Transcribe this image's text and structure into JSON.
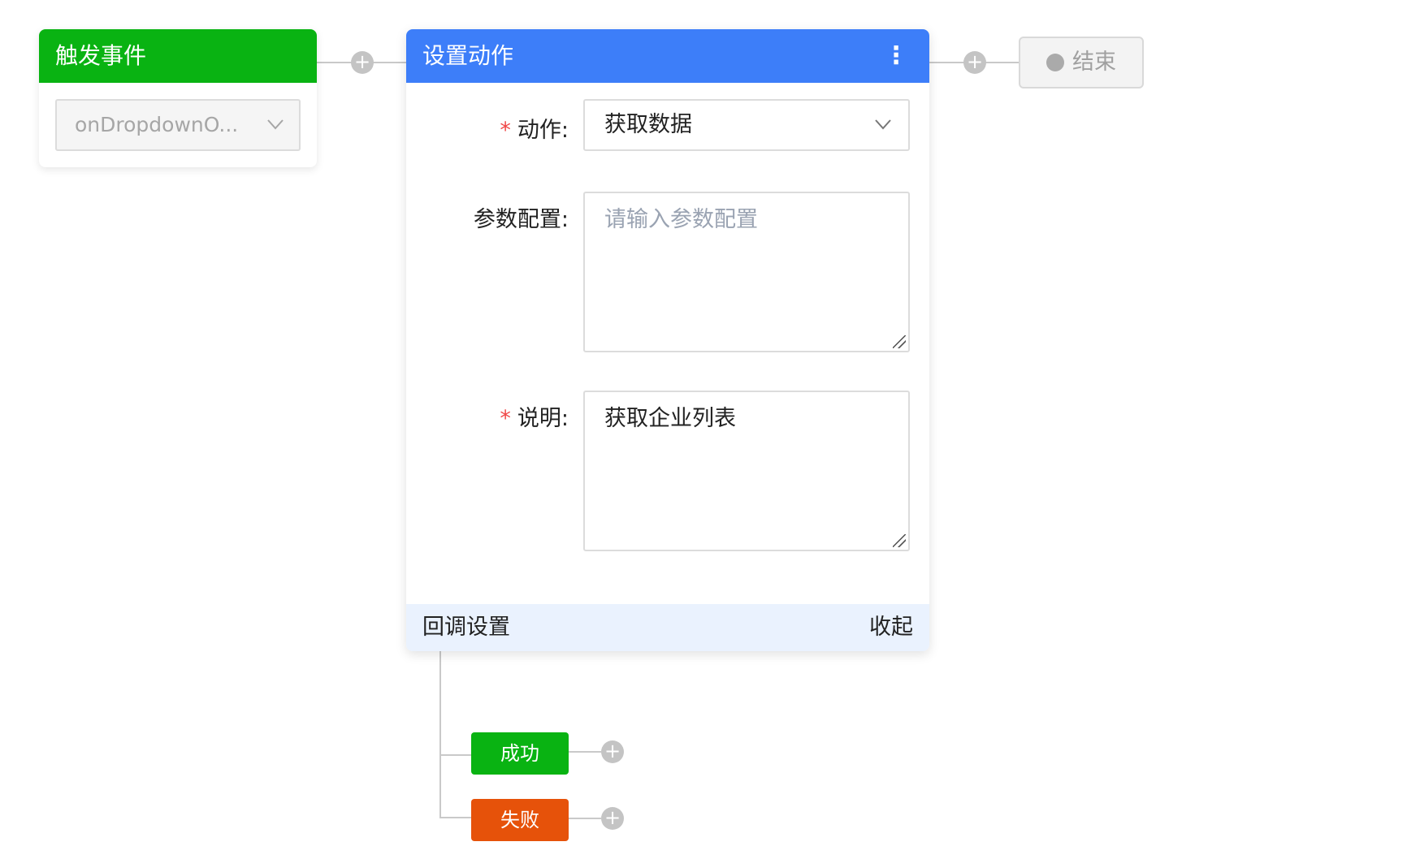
{
  "trigger": {
    "title": "触发事件",
    "event_value": "onDropdownO..."
  },
  "action_card": {
    "title": "设置动作",
    "menu_glyph": "⋮",
    "fields": {
      "action": {
        "label": "动作:",
        "value": "获取数据"
      },
      "params": {
        "label": "参数配置:",
        "placeholder": "请输入参数配置",
        "value": ""
      },
      "description": {
        "label": "说明:",
        "value": "获取企业列表"
      }
    },
    "footer": {
      "callback_label": "回调设置",
      "collapse_label": "收起"
    }
  },
  "end_node": {
    "label": "结束"
  },
  "branches": {
    "success": "成功",
    "failure": "失败"
  },
  "colors": {
    "trigger_header": "#09b312",
    "action_header": "#3d7ef9",
    "success": "#09b312",
    "failure": "#e6520a",
    "footer_bg": "#eaf2fe"
  },
  "icons": {
    "chevron": "chevron-down-icon",
    "plus": "plus-icon",
    "more": "more-vertical-icon",
    "end": "circle-icon"
  }
}
